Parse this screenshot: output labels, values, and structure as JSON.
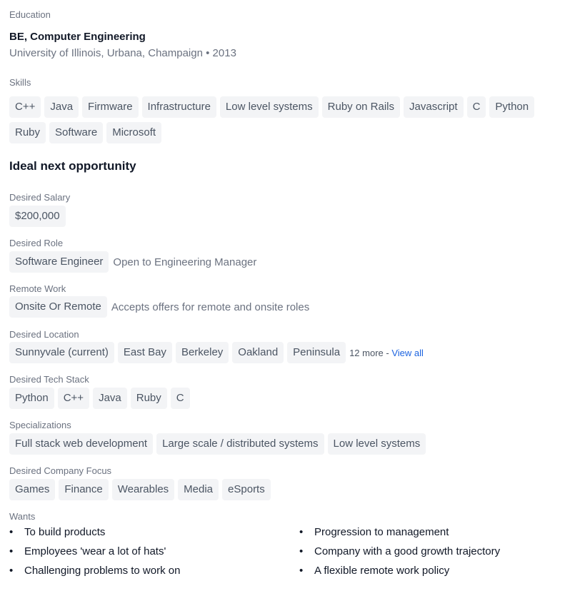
{
  "education": {
    "label": "Education",
    "degree": "BE, Computer Engineering",
    "school": "University of Illinois, Urbana, Champaign • 2013"
  },
  "skills": {
    "label": "Skills",
    "items": [
      "C++",
      "Java",
      "Firmware",
      "Infrastructure",
      "Low level systems",
      "Ruby on Rails",
      "Javascript",
      "C",
      "Python",
      "Ruby",
      "Software",
      "Microsoft"
    ]
  },
  "opportunity": {
    "title": "Ideal next opportunity",
    "salary": {
      "label": "Desired Salary",
      "value": "$200,000"
    },
    "role": {
      "label": "Desired Role",
      "value": "Software Engineer",
      "note": "Open to Engineering Manager"
    },
    "remote": {
      "label": "Remote Work",
      "value": "Onsite Or Remote",
      "note": "Accepts offers for remote and onsite roles"
    },
    "location": {
      "label": "Desired Location",
      "items": [
        "Sunnyvale (current)",
        "East Bay",
        "Berkeley",
        "Oakland",
        "Peninsula"
      ],
      "more_text": "12 more - ",
      "view_all": "View all"
    },
    "tech_stack": {
      "label": "Desired Tech Stack",
      "items": [
        "Python",
        "C++",
        "Java",
        "Ruby",
        "C"
      ]
    },
    "specializations": {
      "label": "Specializations",
      "items": [
        "Full stack web development",
        "Large scale / distributed systems",
        "Low level systems"
      ]
    },
    "company_focus": {
      "label": "Desired Company Focus",
      "items": [
        "Games",
        "Finance",
        "Wearables",
        "Media",
        "eSports"
      ]
    },
    "wants": {
      "label": "Wants",
      "bullet": "•",
      "items": [
        "To build products",
        "Progression to management",
        "Employees 'wear a lot of hats'",
        "Company with a good growth trajectory",
        "Challenging problems to work on",
        "A flexible remote work policy"
      ]
    }
  }
}
